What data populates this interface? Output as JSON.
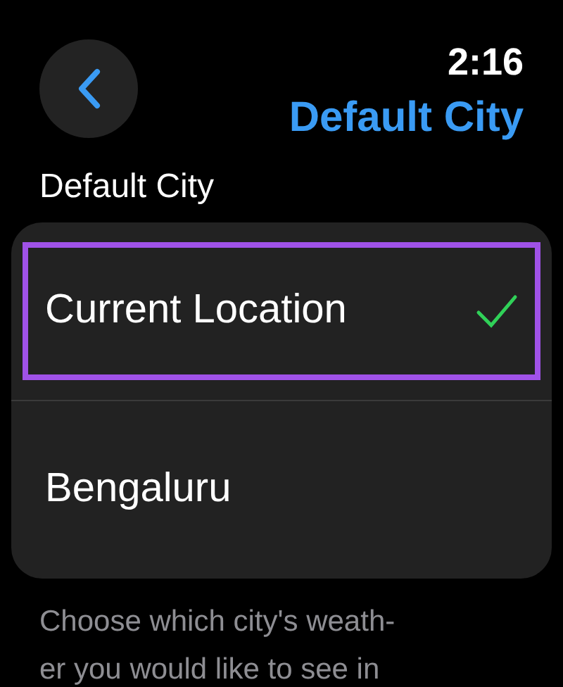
{
  "header": {
    "time": "2:16",
    "title": "Default City"
  },
  "section": {
    "heading": "Default City"
  },
  "cities": [
    {
      "name": "Current Location",
      "selected": true,
      "highlighted": true
    },
    {
      "name": "Bengaluru",
      "selected": false,
      "highlighted": false
    }
  ],
  "footer": "Choose which city's weath-\ner you would like to see in"
}
